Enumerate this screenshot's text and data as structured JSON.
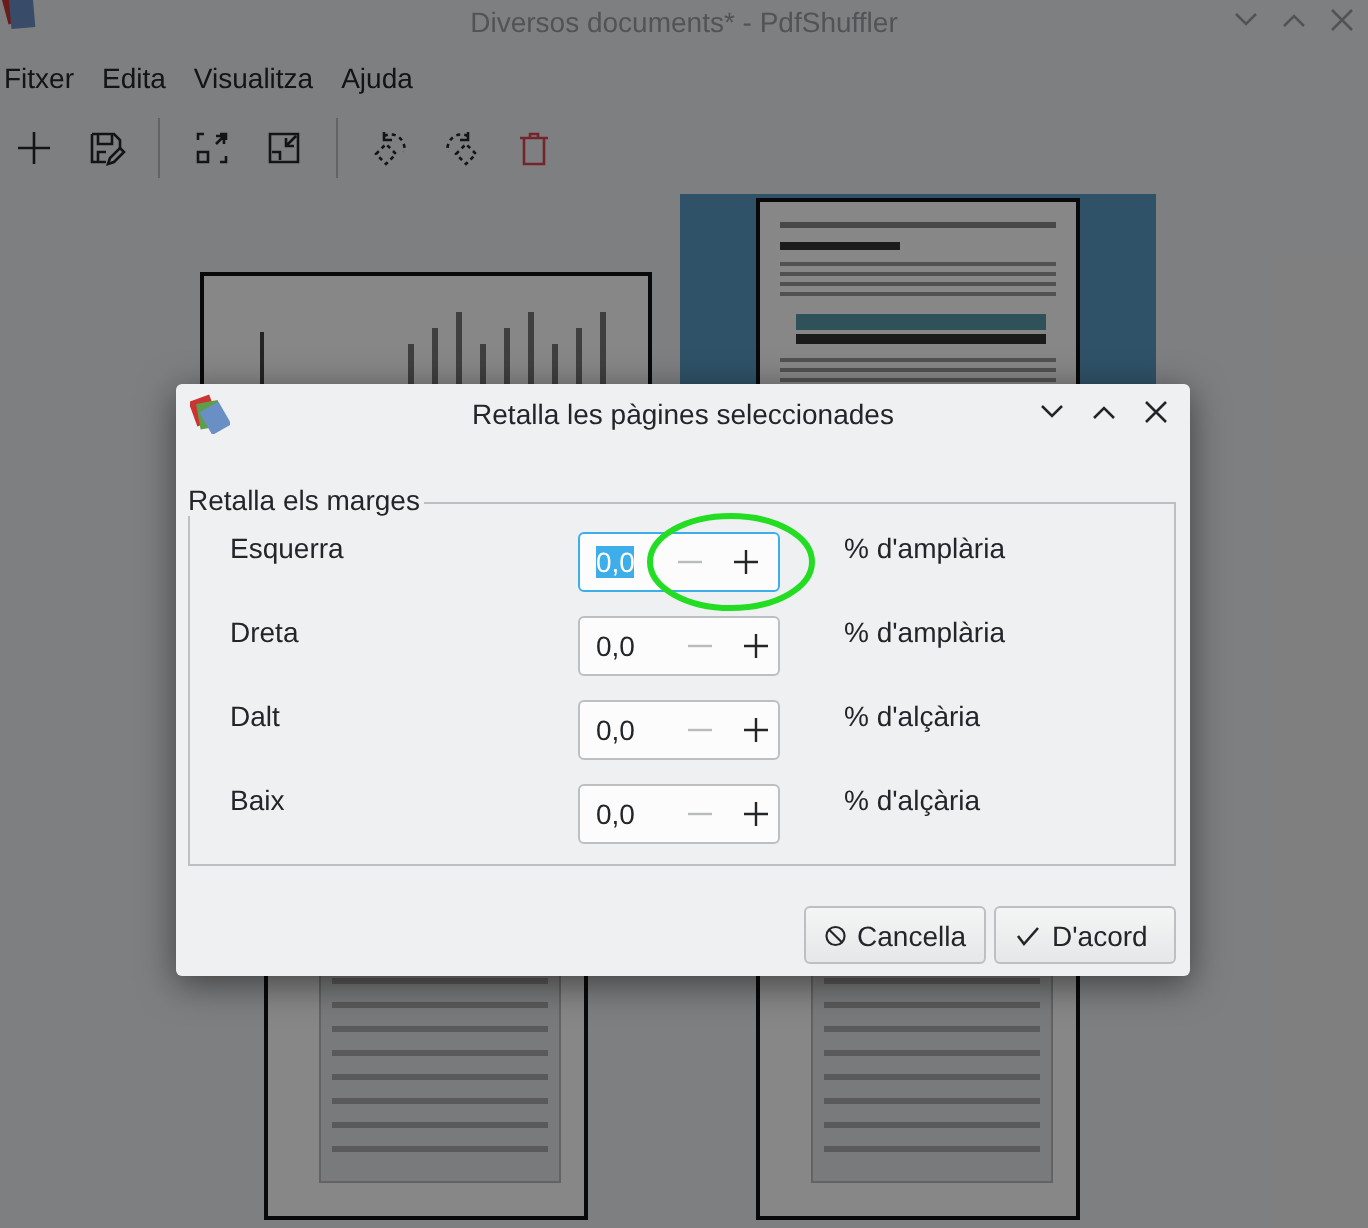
{
  "window": {
    "title": "Diversos documents* - PdfShuffler"
  },
  "menu": [
    "Fitxer",
    "Edita",
    "Visualitza",
    "Ajuda"
  ],
  "pages": [
    {
      "kind": "landscape",
      "selected": false
    },
    {
      "kind": "portrait",
      "selected": true
    },
    {
      "kind": "portrait",
      "selected": false
    },
    {
      "kind": "portrait",
      "selected": false
    }
  ],
  "dialog": {
    "title": "Retalla les pàgines seleccionades",
    "frame_label": "Retalla els marges",
    "rows": [
      {
        "label": "Esquerra",
        "value": "0,0",
        "unit": "% d'amplària",
        "focused": true,
        "can_decrease": false
      },
      {
        "label": "Dreta",
        "value": "0,0",
        "unit": "% d'amplària",
        "focused": false,
        "can_decrease": false
      },
      {
        "label": "Dalt",
        "value": "0,0",
        "unit": "% d'alçària",
        "focused": false,
        "can_decrease": false
      },
      {
        "label": "Baix",
        "value": "0,0",
        "unit": "% d'alçària",
        "focused": false,
        "can_decrease": false
      }
    ],
    "buttons": [
      {
        "label": "Cancella",
        "kind": "cancel"
      },
      {
        "label": "D'acord",
        "kind": "ok"
      }
    ]
  }
}
